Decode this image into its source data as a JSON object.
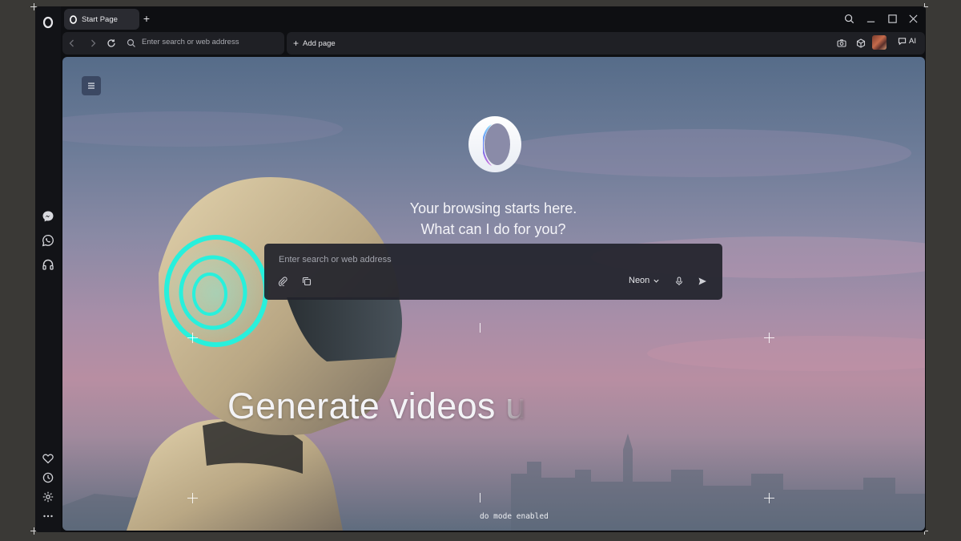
{
  "tab": {
    "title": "Start Page",
    "new_tab": "+"
  },
  "address_bar": {
    "placeholder": "Enter search or web address"
  },
  "toolbar": {
    "add_page_label": "Add page",
    "ai_label": "AI"
  },
  "start_page": {
    "headline_line1": "Your browsing starts here.",
    "headline_line2": "What can I do for you?",
    "search_placeholder": "Enter search or web address",
    "model_selected": "Neon",
    "video_caption_visible": "Generate videos ",
    "video_caption_fading": "u",
    "mode_status": "do mode enabled"
  },
  "colors": {
    "window_bg": "#0e0f12",
    "sidebar_bg": "#121317",
    "bar_bg": "#1f2025",
    "search_card_bg": "#22242c",
    "helmet_ring_accent": "#28f0dc",
    "logo_accent": "#4a6cf0"
  },
  "icons": {
    "sidebar": [
      "opera-logo-icon",
      "messenger-icon",
      "whatsapp-icon",
      "headphones-icon",
      "heart-icon",
      "history-icon",
      "settings-icon",
      "more-icon"
    ],
    "toolbar": [
      "back-icon",
      "forward-icon",
      "reload-icon",
      "search-icon",
      "camera-icon",
      "cube-icon",
      "chat-icon"
    ],
    "window": [
      "search-icon",
      "minimize-icon",
      "maximize-icon",
      "close-icon"
    ],
    "search_card": [
      "paperclip-icon",
      "copy-icon",
      "chevron-down-icon",
      "microphone-icon",
      "send-icon"
    ]
  }
}
